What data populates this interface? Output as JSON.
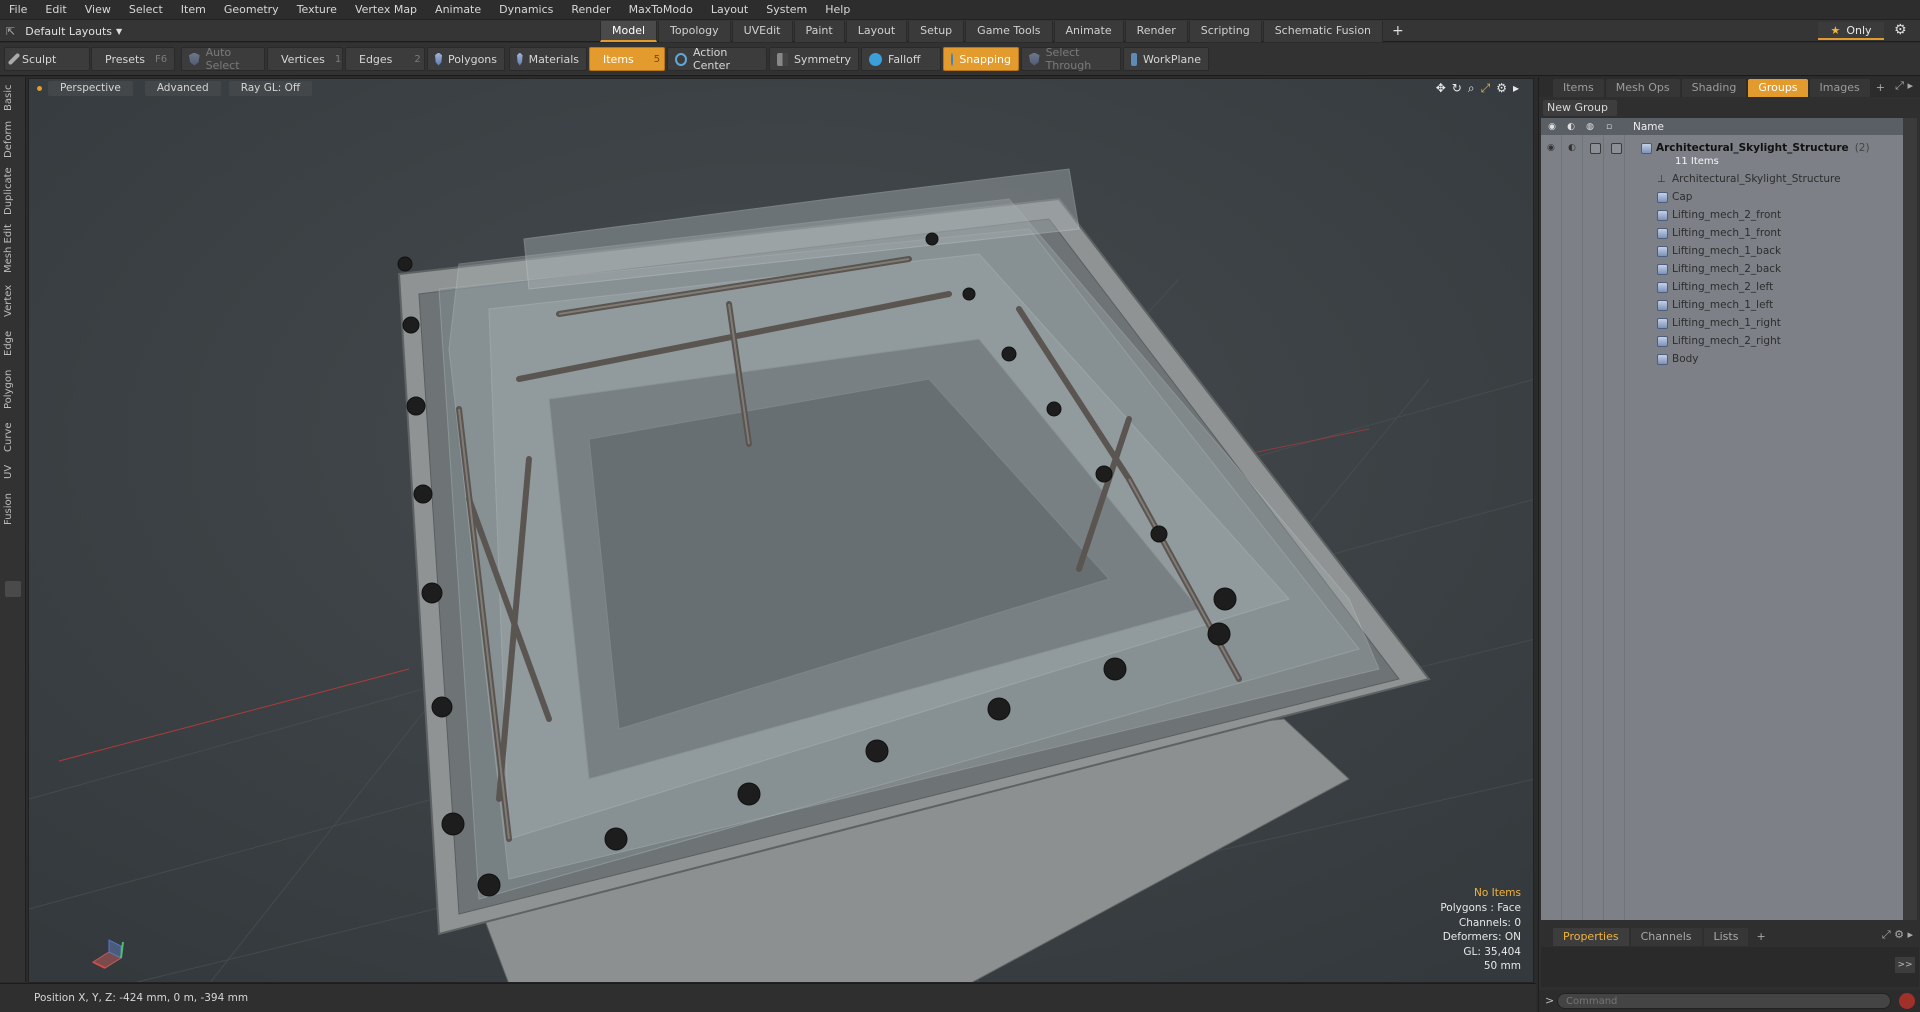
{
  "menu": [
    "File",
    "Edit",
    "View",
    "Select",
    "Item",
    "Geometry",
    "Texture",
    "Vertex Map",
    "Animate",
    "Dynamics",
    "Render",
    "MaxToModo",
    "Layout",
    "System",
    "Help"
  ],
  "layout_select": "Default Layouts",
  "tabs": [
    "Model",
    "Topology",
    "UVEdit",
    "Paint",
    "Layout",
    "Setup",
    "Game Tools",
    "Animate",
    "Render",
    "Scripting",
    "Schematic Fusion"
  ],
  "active_tab": "Model",
  "only_label": "Only",
  "toolbar": {
    "sculpt": "Sculpt",
    "presets": "Presets",
    "presets_key": "F6",
    "auto_select": "Auto Select",
    "vertices": "Vertices",
    "vertices_num": "1",
    "edges": "Edges",
    "edges_num": "2",
    "polygons": "Polygons",
    "materials": "Materials",
    "items": "Items",
    "items_num": "5",
    "action_center": "Action Center",
    "symmetry": "Symmetry",
    "falloff": "Falloff",
    "snapping": "Snapping",
    "select_through": "Select Through",
    "workplane": "WorkPlane"
  },
  "left_tabs": [
    "Basic",
    "Deform",
    "Duplicate",
    "Mesh Edit",
    "Vertex",
    "Edge",
    "Polygon",
    "Curve",
    "UV",
    "Fusion"
  ],
  "viewport": {
    "perspective": "Perspective",
    "advanced": "Advanced",
    "raygl": "Ray GL: Off"
  },
  "hud": {
    "no_items": "No Items",
    "polygons": "Polygons : Face",
    "channels": "Channels: 0",
    "deformers": "Deformers: ON",
    "gl": "GL: 35,404",
    "unit": "50 mm"
  },
  "status": {
    "position": "Position X, Y, Z:   -424 mm, 0 m, -394 mm"
  },
  "right_tabs": [
    "Items",
    "Mesh Ops",
    "Shading",
    "Groups",
    "Images"
  ],
  "right_active_tab": "Groups",
  "new_group": "New Group",
  "col_name": "Name",
  "group": {
    "name": "Architectural_Skylight_Structure",
    "count": "(2)",
    "items_count": "11 Items",
    "children": [
      "Architectural_Skylight_Structure",
      "Cap",
      "Lifting_mech_2_front",
      "Lifting_mech_1_front",
      "Lifting_mech_1_back",
      "Lifting_mech_2_back",
      "Lifting_mech_2_left",
      "Lifting_mech_1_left",
      "Lifting_mech_1_right",
      "Lifting_mech_2_right",
      "Body"
    ]
  },
  "bottom_tabs": [
    "Properties",
    "Channels",
    "Lists"
  ],
  "bottom_active_tab": "Properties",
  "command_placeholder": "Command",
  "colors": {
    "accent": "#e39b2d",
    "viewport_bg": "#3a4043",
    "tree_bg": "#7d8187"
  }
}
